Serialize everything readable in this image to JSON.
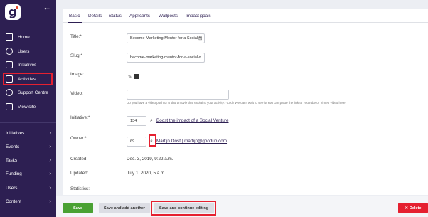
{
  "sidebar": {
    "logo_letter": "g",
    "back_icon": "left-arrow-icon",
    "items": [
      {
        "label": "Home",
        "icon": "home-icon"
      },
      {
        "label": "Users",
        "icon": "user-icon"
      },
      {
        "label": "Initiatives",
        "icon": "edit-icon"
      },
      {
        "label": "Activities",
        "icon": "calendar-icon"
      },
      {
        "label": "Support Centre",
        "icon": "help-icon"
      },
      {
        "label": "View site",
        "icon": "monitor-icon"
      }
    ],
    "groups": [
      {
        "label": "Initiatives"
      },
      {
        "label": "Events"
      },
      {
        "label": "Tasks"
      },
      {
        "label": "Funding"
      },
      {
        "label": "Users"
      },
      {
        "label": "Content"
      }
    ]
  },
  "tabs": [
    "Basic",
    "Details",
    "Status",
    "Applicants",
    "Wallposts",
    "Impact goals"
  ],
  "form": {
    "title_label": "Title:*",
    "title_value": "Become Marketing Mentor for a Social V",
    "slug_label": "Slug:*",
    "slug_value": "become-marketing-mentor-for-a-social-v",
    "image_label": "Image:",
    "video_label": "Video:",
    "video_help": "Do you have a video pitch or a short movie that explains your activity? Cool! We can't wait to see it! You can paste the link to YouTube or Vimeo video here",
    "initiative_label": "Initiative:*",
    "initiative_id": "134",
    "initiative_link": "Boost the impact of a Social Venture",
    "owner_label": "Owner:*",
    "owner_id": "69",
    "owner_link": "Martijn Oost | martijn@goodup.com",
    "created_label": "Created:",
    "created_value": "Dec. 3, 2019, 9:22 a.m.",
    "updated_label": "Updated:",
    "updated_value": "July 1, 2020, 5 a.m.",
    "statistics_label": "Statistics:"
  },
  "footer": {
    "save": "Save",
    "save_add": "Save and add another",
    "save_continue": "Save and continue editing",
    "delete": "✕ Delete"
  }
}
